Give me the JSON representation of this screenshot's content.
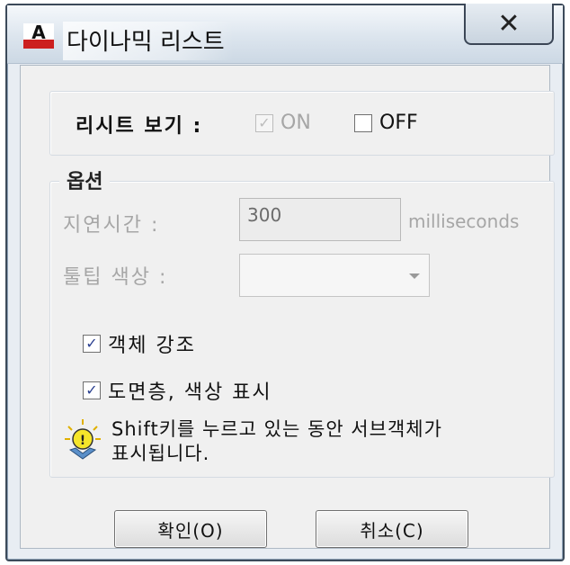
{
  "window": {
    "title": "다이나믹 리스트",
    "app_icon_letter": "A"
  },
  "list_view": {
    "label": "리시트 보기 :",
    "on": {
      "label": "ON",
      "checked": true,
      "disabled": true
    },
    "off": {
      "label": "OFF",
      "checked": false,
      "disabled": false
    }
  },
  "options": {
    "caption": "옵션",
    "delay": {
      "label": "지연시간 :",
      "value": "300",
      "unit": "milliseconds"
    },
    "tooltip_color": {
      "label": "툴팁 색상 :",
      "value": ""
    },
    "highlight_object": {
      "label": "객체 강조",
      "checked": true
    },
    "show_layer_color": {
      "label": "도면층, 색상 표시",
      "checked": true
    },
    "tip": {
      "line1": "Shift키를 누르고 있는 동안 서브객체가",
      "line2": "표시됩니다."
    }
  },
  "buttons": {
    "ok": "확인(O)",
    "cancel": "취소(C)"
  },
  "colors": {
    "title_icon_red": "#cc1f1f",
    "check_blue": "#2a3f8f",
    "tip_yellow": "#f5e52a"
  }
}
